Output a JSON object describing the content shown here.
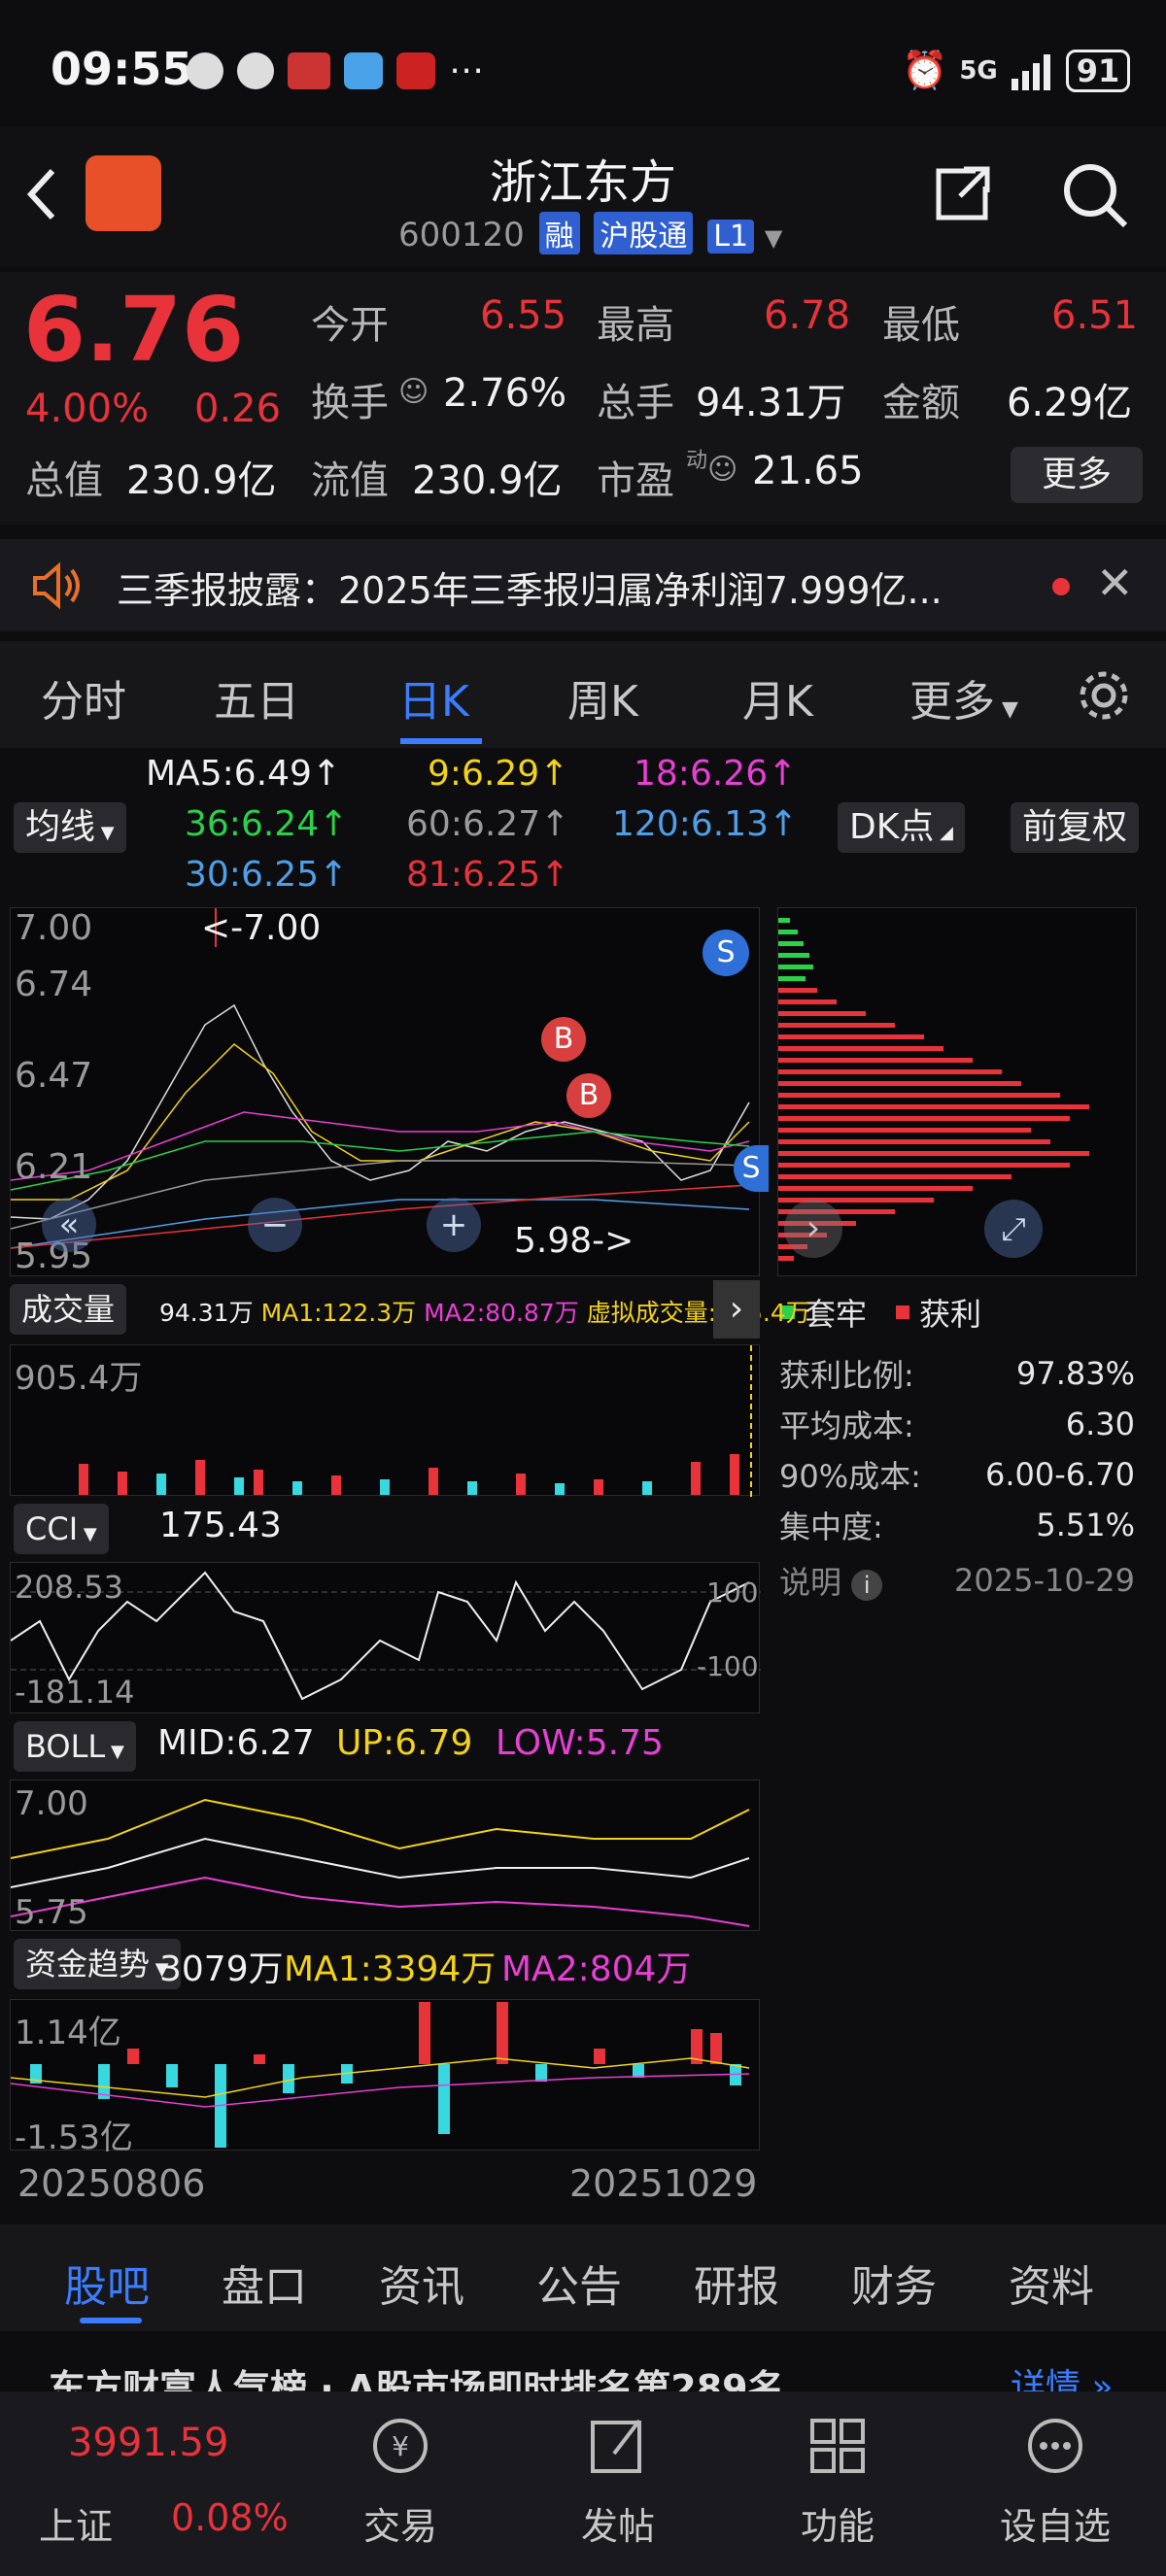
{
  "status": {
    "time": "09:55",
    "network": "5G",
    "battery": "91"
  },
  "header": {
    "title": "浙江东方",
    "code": "600120",
    "tag1": "融",
    "tag2": "沪股通",
    "tag3": "L1"
  },
  "quote": {
    "price": "6.76",
    "change_pct": "4.00%",
    "change": "0.26",
    "open_label": "今开",
    "open": "6.55",
    "high_label": "最高",
    "high": "6.78",
    "low_label": "最低",
    "low": "6.51",
    "turnover_label": "换手",
    "turnover": "2.76%",
    "volume_label": "总手",
    "volume": "94.31万",
    "amount_label": "金额",
    "amount": "6.29亿",
    "mktcap_label": "总值",
    "mktcap": "230.9亿",
    "float_label": "流值",
    "float": "230.9亿",
    "pe_label": "市盈",
    "pe_sup": "动",
    "pe": "21.65",
    "more": "更多"
  },
  "news": {
    "text": "三季报披露：2025年三季报归属净利润7.999亿..."
  },
  "ktabs": [
    "分时",
    "五日",
    "日K",
    "周K",
    "月K",
    "更多"
  ],
  "ma": {
    "select": "均线",
    "ma5": "MA5:6.49↑",
    "ma9": "9:6.29↑",
    "ma18": "18:6.26↑",
    "ma36": "36:6.24↑",
    "ma60": "60:6.27↑",
    "ma120": "120:6.13↑",
    "ma30": "30:6.25↑",
    "ma81": "81:6.25↑",
    "dk": "DK点",
    "fq": "前复权"
  },
  "kline": {
    "y_labels": [
      "7.00",
      "6.74",
      "6.47",
      "6.21",
      "5.95"
    ],
    "max_note": "<-7.00",
    "min_note": "5.98->"
  },
  "chip": {
    "legend_trap": "套牢",
    "legend_profit": "获利",
    "rows": [
      {
        "k": "获利比例:",
        "v": "97.83%"
      },
      {
        "k": "平均成本:",
        "v": "6.30"
      },
      {
        "k": "90%成本:",
        "v": "6.00-6.70"
      },
      {
        "k": "集中度:",
        "v": "5.51%"
      }
    ],
    "note": "说明",
    "date": "2025-10-29"
  },
  "vol": {
    "select": "成交量",
    "v": "94.31万",
    "ma1": "MA1:122.3万",
    "ma2": "MA2:80.87万",
    "virt": "虚拟成交量:905.4万",
    "top": "905.4万"
  },
  "cci": {
    "select": "CCI",
    "v": "175.43",
    "top": "208.53",
    "bot": "-181.14",
    "r100": "100",
    "rm100": "-100"
  },
  "boll": {
    "select": "BOLL",
    "mid": "MID:6.27",
    "up": "UP:6.79",
    "low": "LOW:5.75",
    "top": "7.00",
    "bot": "5.75"
  },
  "fund": {
    "select": "资金趋势",
    "v": "3079万",
    "ma1": "MA1:3394万",
    "ma2": "MA2:804万",
    "top": "1.14亿",
    "bot": "-1.53亿"
  },
  "dates": {
    "start": "20250806",
    "end": "20251029"
  },
  "subnav": [
    "股吧",
    "盘口",
    "资讯",
    "公告",
    "研报",
    "财务",
    "资料"
  ],
  "ticker": {
    "text": "东方财富人气榜 · A股市场即时排名第289名",
    "more": "详情 »"
  },
  "dock": {
    "index_value": "3991.59",
    "index_name": "上证",
    "index_pct": "0.08%",
    "items": [
      "交易",
      "发帖",
      "功能",
      "设自选"
    ]
  },
  "colors": {
    "up": "#e8333b",
    "down": "#38d8e0",
    "accent": "#3b7dff"
  }
}
